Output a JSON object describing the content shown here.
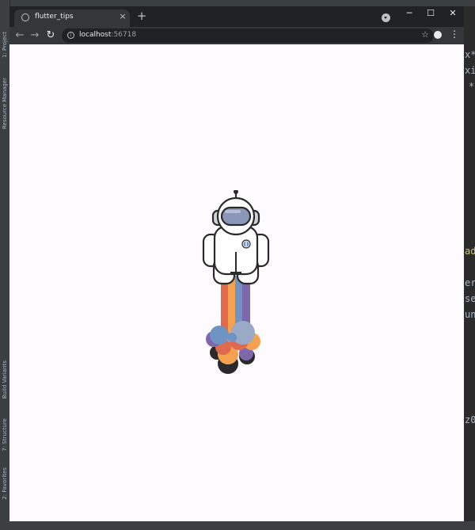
{
  "ide": {
    "left_tabs": [
      "1: Project",
      "Resource Manager",
      "Build Variants",
      "7: Structure",
      "2: Favorites"
    ],
    "code_fragments": [
      "x*",
      "xi",
      "*",
      "ad",
      "er",
      "se",
      "un",
      "z0"
    ]
  },
  "browser": {
    "tab_title": "flutter_tips",
    "tab_close": "×",
    "new_tab": "+",
    "window_controls": {
      "minimize": "─",
      "maximize": "☐",
      "close": "✕"
    },
    "nav": {
      "back": "←",
      "forward": "→",
      "reload": "↻"
    },
    "url_host": "localhost",
    "url_port": ":56718",
    "star": "☆",
    "menu": "⋮"
  },
  "page": {
    "illustration": "astronaut-with-rainbow-rocket-trail",
    "colors": {
      "background": "#fdfbfe",
      "trail": [
        "#e0694e",
        "#f4a24f",
        "#6f93c3",
        "#7e68ad"
      ],
      "visor": "#8b97b9",
      "outline": "#2a2a2a"
    }
  }
}
